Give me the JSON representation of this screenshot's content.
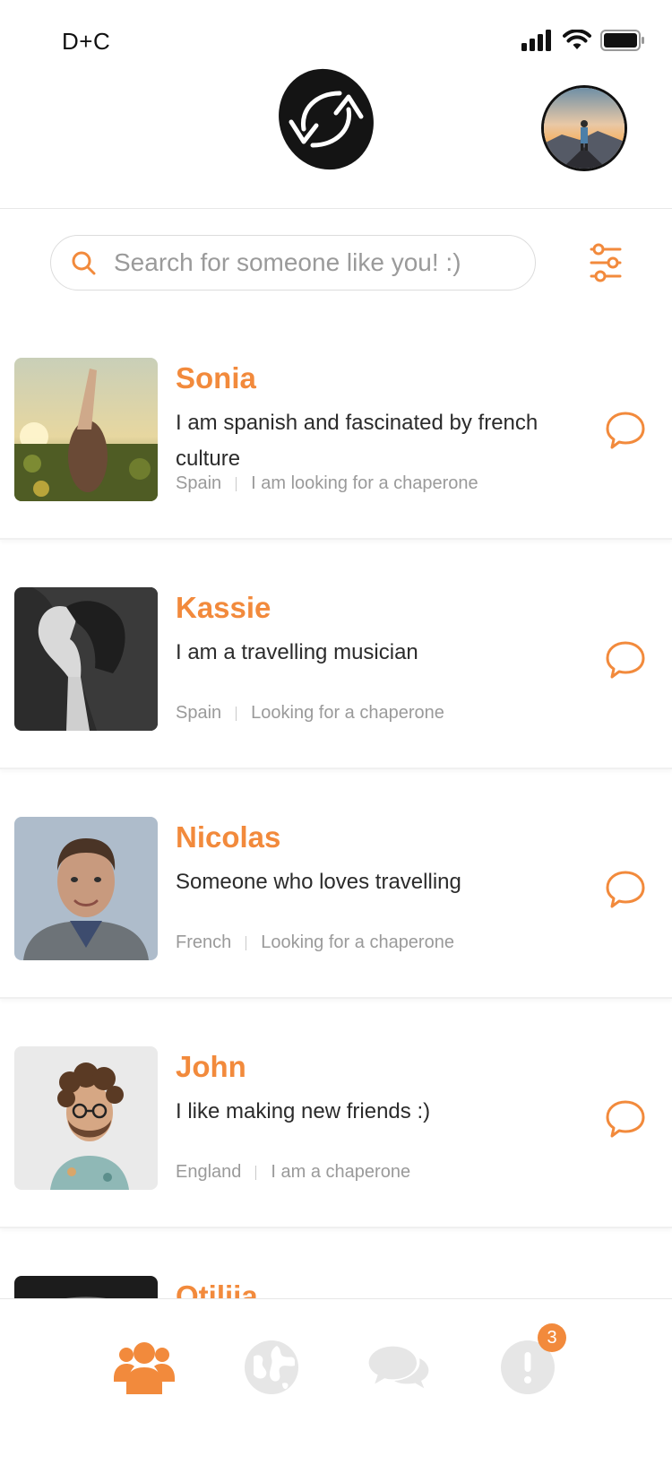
{
  "status_bar": {
    "carrier": "D+C"
  },
  "search": {
    "placeholder": "Search for someone like you! :)"
  },
  "users": [
    {
      "name": "Sonia",
      "bio": "I am spanish and fascinated by french culture",
      "country": "Spain",
      "status": "I am looking for a chaperone"
    },
    {
      "name": "Kassie",
      "bio": "I am a travelling musician",
      "country": "Spain",
      "status": "Looking for a chaperone"
    },
    {
      "name": "Nicolas",
      "bio": "Someone who loves travelling",
      "country": "French",
      "status": "Looking for a chaperone"
    },
    {
      "name": "John",
      "bio": "I like making new friends :)",
      "country": "England",
      "status": "I am a chaperone"
    },
    {
      "name": "Otilija",
      "bio": "",
      "country": "",
      "status": ""
    }
  ],
  "bottom_nav": {
    "items": [
      {
        "icon": "people-icon",
        "active": true
      },
      {
        "icon": "globe-icon",
        "active": false
      },
      {
        "icon": "chat-bubbles-icon",
        "active": false
      },
      {
        "icon": "alert-icon",
        "active": false,
        "badge": "3"
      }
    ]
  },
  "colors": {
    "accent": "#f28a3c",
    "inactive_icon": "#e6e6e6",
    "muted_text": "#9a9a9a"
  }
}
